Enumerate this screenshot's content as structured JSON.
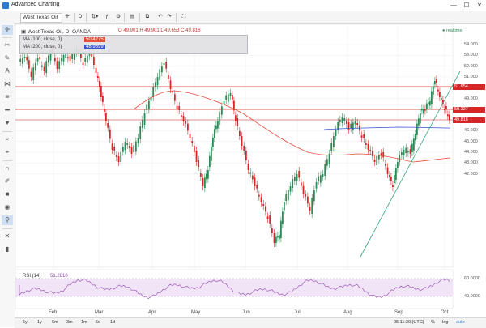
{
  "window": {
    "title": "Advanced Charting",
    "minimize": "—",
    "maximize": "☐",
    "close": "✕"
  },
  "toolbar": {
    "symbol": "West Texas Oil",
    "interval": "D"
  },
  "legend": {
    "instrument": "West Texas Oil, D, OANDA",
    "ohlc": "O 49.901  H 49.901  L 49.653  C 49.816",
    "ma1_label": "MA (100, close, 0)",
    "ma1_value": "50.4275",
    "ma2_label": "MA (200, close, 0)",
    "ma2_value": "48.9599",
    "realtime": "realtime"
  },
  "axis": {
    "prices": [
      "54.000",
      "53.000",
      "52.000",
      "51.000",
      "50.000",
      "49.000",
      "48.000",
      "47.000",
      "46.000",
      "45.000",
      "44.000",
      "43.000",
      "42.000"
    ],
    "months": [
      "Feb",
      "Mar",
      "Apr",
      "May",
      "Jun",
      "Jul",
      "Aug",
      "Sep",
      "Oct"
    ],
    "rsi_ticks": [
      "60.0000",
      "40.0000"
    ]
  },
  "price_tags": [
    {
      "text": "51.654",
      "color": "#d62728"
    },
    {
      "text": "50.327",
      "color": "#d62728"
    },
    {
      "text": "49.816",
      "color": "#d62728"
    }
  ],
  "rsi": {
    "label": "RSI (14)",
    "value": "51.2810"
  },
  "statusbar": {
    "ranges": [
      "5y",
      "1y",
      "6m",
      "3m",
      "1m",
      "5d",
      "1d"
    ],
    "time": "05:11:30 (UTC)",
    "pct": "%",
    "log": "log",
    "auto": "auto"
  },
  "colors": {
    "up": "#2e8b57",
    "down": "#d62728",
    "ma100": "#e74c3c",
    "ma200": "#3a53d6",
    "trend": "#3aa57a",
    "rsi": "#9b59b6"
  }
}
